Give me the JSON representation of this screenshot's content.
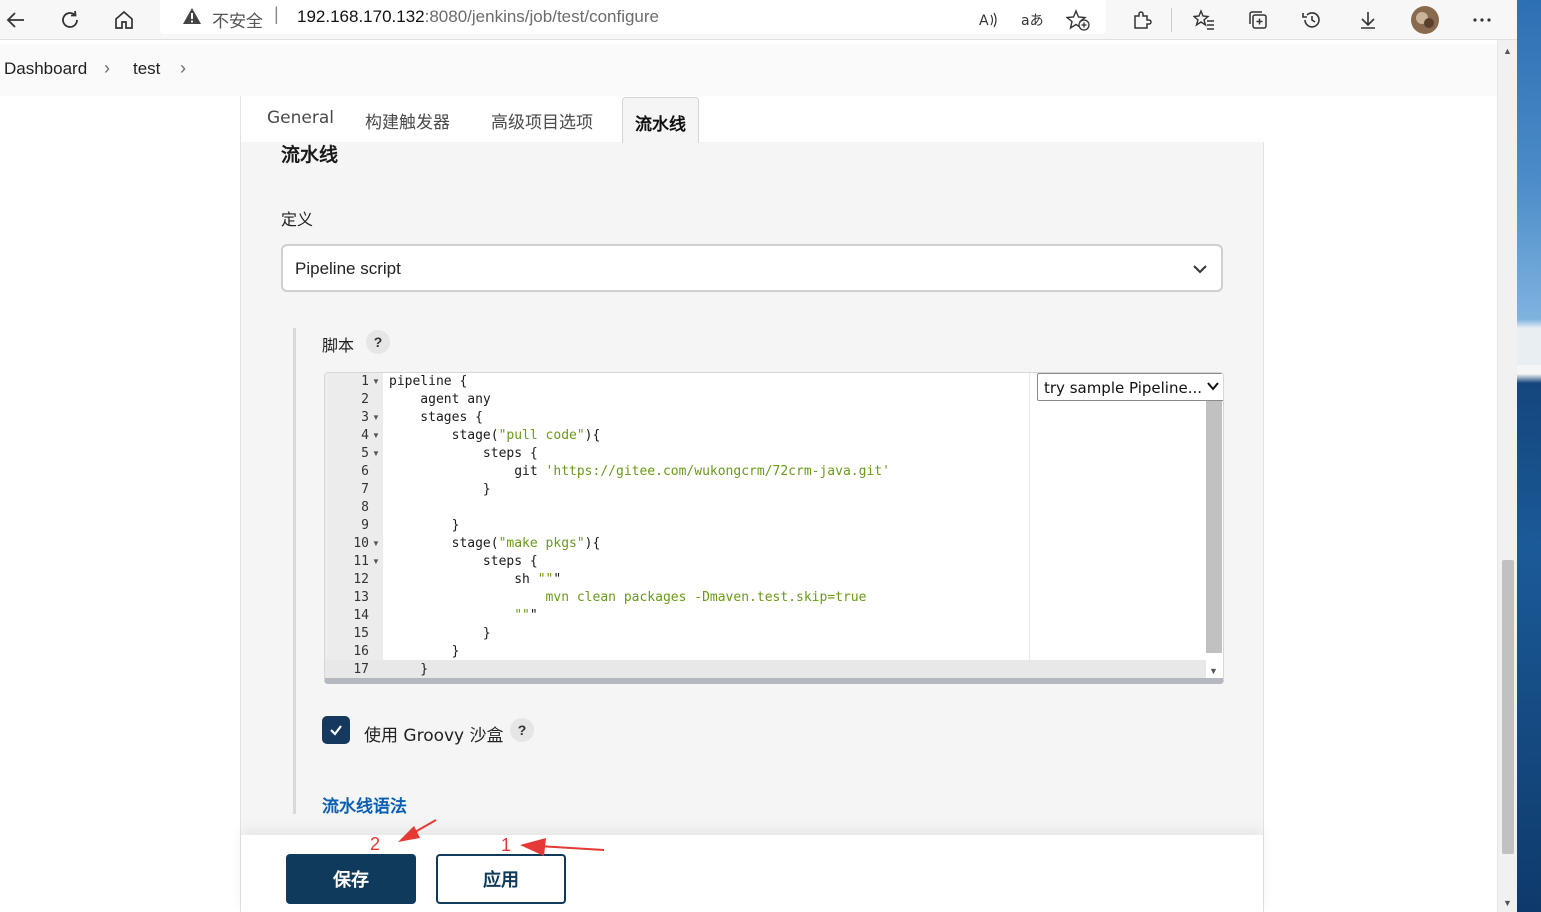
{
  "browser": {
    "security_label": "不安全",
    "url_host": "192.168.170.132",
    "url_path": ":8080/jenkins/job/test/configure",
    "icons": [
      "back-icon",
      "refresh-icon",
      "home-icon",
      "warning-icon",
      "read-aloud-icon",
      "translate-icon",
      "add-favorite-icon",
      "extensions-icon",
      "favorites-icon",
      "collections-icon",
      "history-icon",
      "download-icon",
      "profile-avatar",
      "more-icon"
    ]
  },
  "breadcrumb": {
    "items": [
      "Dashboard",
      "test"
    ]
  },
  "tabs": [
    "General",
    "构建触发器",
    "高级项目选项",
    "流水线"
  ],
  "active_tab": "流水线",
  "pipeline": {
    "section_title": "流水线",
    "definition_label": "定义",
    "definition_value": "Pipeline script",
    "script_label": "脚本",
    "help_symbol": "?",
    "sample_select": "try sample Pipeline...",
    "line_numbers": [
      "1",
      "2",
      "3",
      "4",
      "5",
      "6",
      "7",
      "8",
      "9",
      "10",
      "11",
      "12",
      "13",
      "14",
      "15",
      "16",
      "17"
    ],
    "code_lines": [
      "pipeline {",
      "    agent any",
      "    stages {",
      "        stage(\"pull code\"){",
      "            steps {",
      "                git 'https://gitee.com/wukongcrm/72crm-java.git'",
      "            }",
      "",
      "        }",
      "        stage(\"make pkgs\"){",
      "            steps {",
      "                sh \"\"\"",
      "                    mvn clean packages -Dmaven.test.skip=true",
      "                \"\"\"",
      "            }",
      "        }",
      "    }"
    ],
    "sandbox_label": "使用 Groovy 沙盒",
    "sandbox_checked": true,
    "syntax_link": "流水线语法"
  },
  "actions": {
    "save": "保存",
    "apply": "应用"
  },
  "annotations": {
    "first": "1",
    "second": "2"
  },
  "colors": {
    "primary": "#0f3a5c",
    "link": "#0b5fb0",
    "string": "#6a9a1a",
    "annotation": "#e53935"
  }
}
